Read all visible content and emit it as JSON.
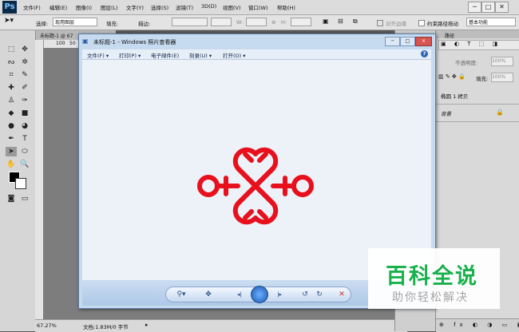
{
  "app": {
    "logo": "Ps",
    "title_bar_controls": [
      "─",
      "□",
      "✕"
    ]
  },
  "menubar": [
    "文件(F)",
    "编辑(E)",
    "图像(I)",
    "图层(L)",
    "文字(Y)",
    "选择(S)",
    "滤镜(T)",
    "3D(D)",
    "视图(V)",
    "窗口(W)",
    "帮助(H)"
  ],
  "options": {
    "select_label": "选择:",
    "layer_mode": "现用图层",
    "fill_label": "填充:",
    "stroke_label": "描边:",
    "w_label": "W:",
    "h_label": "H:",
    "align_edges": "对齐边缘",
    "path_drag": "约束路径拖动",
    "workspace": "基本功能"
  },
  "document": {
    "tab": "未标题-1 @ 67",
    "ruler_marks": [
      "100",
      "50"
    ],
    "zoom": "67.27%",
    "doc_info": "文档:1.83M/0 字节"
  },
  "viewer": {
    "title": "未标题-1 - Windows 照片查看器",
    "menu": [
      "文件(F) ▾",
      "打印(P) ▾",
      "电子邮件(E)",
      "刻录(U) ▾",
      "打开(O) ▾"
    ],
    "help": "?"
  },
  "layers": {
    "tab": "路径",
    "opacity_label": "不透明度:",
    "opacity": "100%",
    "fill_label": "填充:",
    "fill": "100%",
    "copy_layer": "椭圆 1 拷贝",
    "background": "背景"
  },
  "watermark": {
    "title": "百科全说",
    "subtitle": "助你轻松解决"
  },
  "colors": {
    "logo_red": "#e8101c",
    "fill_swatch": "#e00000",
    "watermark_green": "#19b14c"
  }
}
